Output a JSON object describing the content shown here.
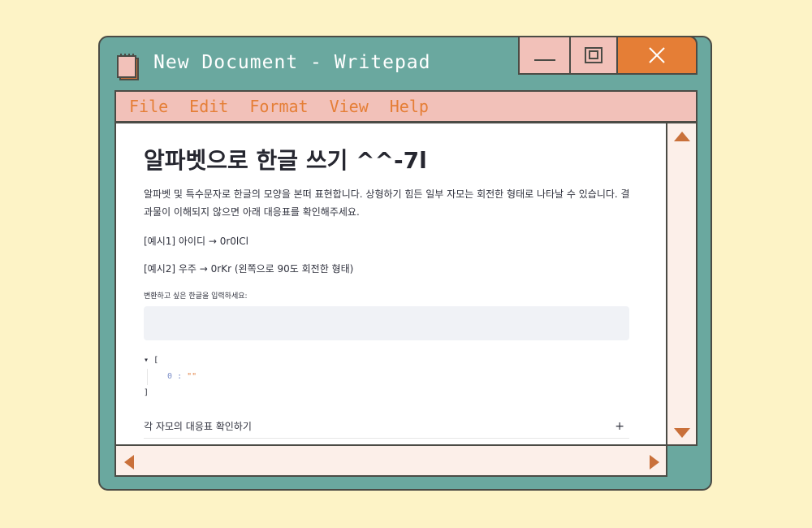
{
  "window": {
    "title": "New Document - Writepad",
    "icons": {
      "document": "document-icon",
      "minimize": "minimize-icon",
      "maximize": "maximize-icon",
      "close": "close-icon"
    }
  },
  "menu": {
    "items": [
      "File",
      "Edit",
      "Format",
      "View",
      "Help"
    ]
  },
  "page": {
    "heading": "알파벳으로 한글 쓰기 ^^-7l",
    "description": "알파벳 및 특수문자로 한글의 모양을 본떠 표현합니다. 상형하기 힘든 일부 자모는 회전한 형태로 나타날 수 있습니다. 결과물이 이해되지 않으면 아래 대응표를 확인해주세요.",
    "example1": "[예시1] 아이디 → 0r0lCl",
    "example2": "[예시2] 우주 → 0rKr (왼쪽으로 90도 회전한 형태)",
    "input_label": "변환하고 싶은 한글을 입력하세요:",
    "input_value": "",
    "json": {
      "toggle": "▾",
      "open": "[",
      "key": "0",
      "sep": ":",
      "value": "\"\"",
      "close": "]"
    },
    "expander_label": "각 자모의 대응표 확인하기",
    "expander_icon": "+"
  },
  "colors": {
    "background": "#fdf3c6",
    "window_frame": "#6aa89f",
    "menu_bar": "#f2c1b9",
    "accent": "#e57e36",
    "scroll_arrow": "#c9703a"
  }
}
